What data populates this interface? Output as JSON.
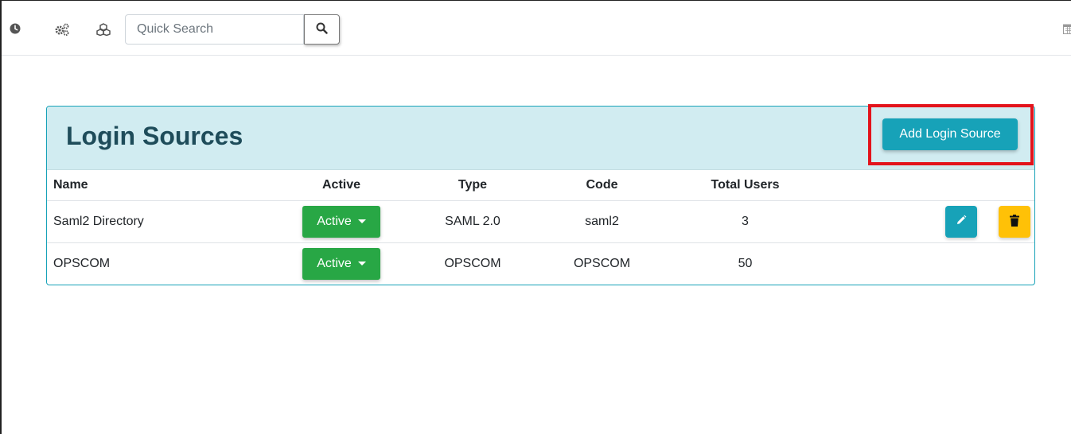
{
  "toolbar": {
    "icons": [
      "clock-icon",
      "gears-icon",
      "cubes-icon",
      "calendar-icon"
    ],
    "search": {
      "placeholder": "Quick Search",
      "value": ""
    }
  },
  "panel": {
    "title": "Login Sources",
    "add_button_label": "Add Login Source",
    "highlight_color": "#e3131b",
    "columns": {
      "name": "Name",
      "active": "Active",
      "type": "Type",
      "code": "Code",
      "total_users": "Total Users"
    },
    "rows": [
      {
        "name": "Saml2 Directory",
        "status": "Active",
        "type": "SAML 2.0",
        "code": "saml2",
        "total_users": "3",
        "has_actions": true
      },
      {
        "name": "OPSCOM",
        "status": "Active",
        "type": "OPSCOM",
        "code": "OPSCOM",
        "total_users": "50",
        "has_actions": false
      }
    ]
  },
  "colors": {
    "info": "#17a2b8",
    "success": "#28a745",
    "warning": "#ffc107",
    "header_bg": "#d1ecf1",
    "title": "#1e4c5a"
  }
}
